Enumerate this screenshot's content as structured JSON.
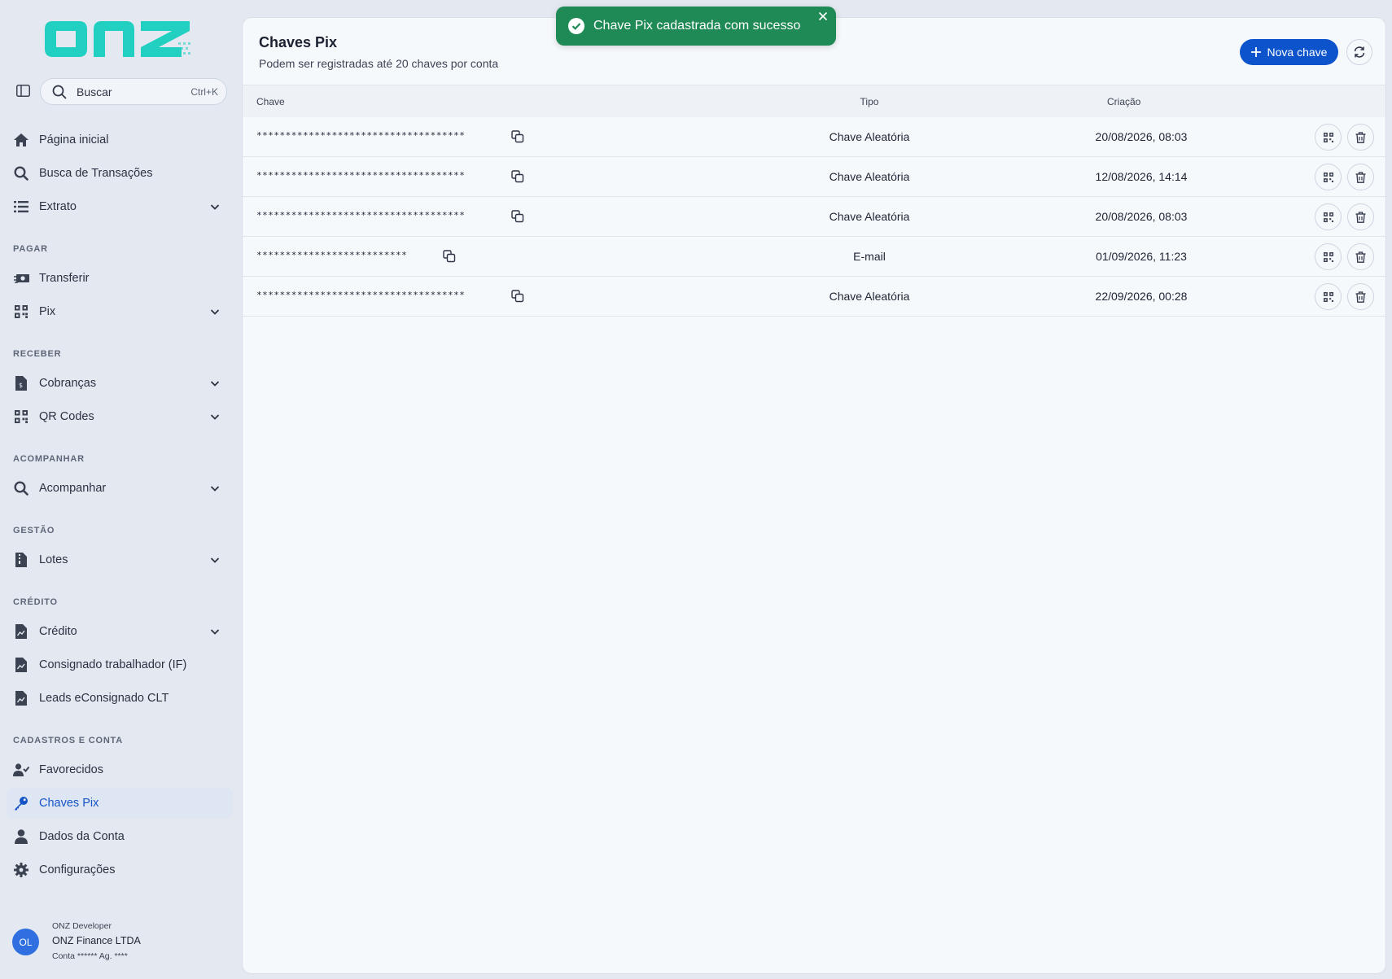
{
  "app": {
    "logo_text": "onz",
    "brand_color": "#21d0c0",
    "accent_color": "#0d54cc",
    "success_color": "#1f8a55"
  },
  "search": {
    "label": "Buscar",
    "shortcut": "Ctrl+K"
  },
  "sidebar": {
    "items_top": [
      {
        "label": "Página inicial",
        "icon": "home-icon"
      },
      {
        "label": "Busca de Transações",
        "icon": "search-icon"
      },
      {
        "label": "Extrato",
        "icon": "list-icon"
      }
    ],
    "sections": [
      {
        "title": "PAGAR",
        "items": [
          {
            "label": "Transferir",
            "icon": "money-transfer-icon"
          },
          {
            "label": "Pix",
            "icon": "qr-grid-icon"
          }
        ]
      },
      {
        "title": "RECEBER",
        "items": [
          {
            "label": "Cobranças",
            "icon": "invoice-icon"
          },
          {
            "label": "QR Codes",
            "icon": "qr-grid-icon"
          }
        ]
      },
      {
        "title": "ACOMPANHAR",
        "items": [
          {
            "label": "Acompanhar",
            "icon": "search-icon"
          }
        ]
      },
      {
        "title": "GESTÃO",
        "items": [
          {
            "label": "Lotes",
            "icon": "document-zip-icon"
          }
        ]
      },
      {
        "title": "CRÉDITO",
        "items": [
          {
            "label": "Crédito",
            "icon": "document-chart-icon"
          },
          {
            "label": "Consignado trabalhador (IF)",
            "icon": "document-chart-icon"
          },
          {
            "label": "Leads eConsignado CLT",
            "icon": "document-chart-icon"
          }
        ]
      },
      {
        "title": "CADASTROS E CONTA",
        "items": [
          {
            "label": "Favorecidos",
            "icon": "user-check-icon"
          },
          {
            "label": "Chaves Pix",
            "icon": "key-icon",
            "active": true
          },
          {
            "label": "Dados da Conta",
            "icon": "user-icon"
          },
          {
            "label": "Configurações",
            "icon": "gear-icon"
          }
        ]
      }
    ]
  },
  "user": {
    "initials": "OL",
    "role": "ONZ Developer",
    "company": "ONZ Finance LTDA",
    "account": "Conta ****** Ag. ****"
  },
  "main": {
    "title": "Chaves Pix",
    "subtitle": "Podem ser registradas até 20 chaves por conta",
    "new_key_label": "Nova chave",
    "columns": {
      "chave": "Chave",
      "tipo": "Tipo",
      "criacao": "Criação"
    },
    "rows": [
      {
        "chave": "************************************",
        "tipo": "Chave Aleatória",
        "criacao": "20/08/2026, 08:03"
      },
      {
        "chave": "************************************",
        "tipo": "Chave Aleatória",
        "criacao": "12/08/2026, 14:14"
      },
      {
        "chave": "************************************",
        "tipo": "Chave Aleatória",
        "criacao": "20/08/2026, 08:03"
      },
      {
        "chave": "**************************",
        "tipo": "E-mail",
        "criacao": "01/09/2026, 11:23"
      },
      {
        "chave": "************************************",
        "tipo": "Chave Aleatória",
        "criacao": "22/09/2026, 00:28"
      }
    ]
  },
  "toast": {
    "message": "Chave Pix cadastrada com sucesso"
  }
}
